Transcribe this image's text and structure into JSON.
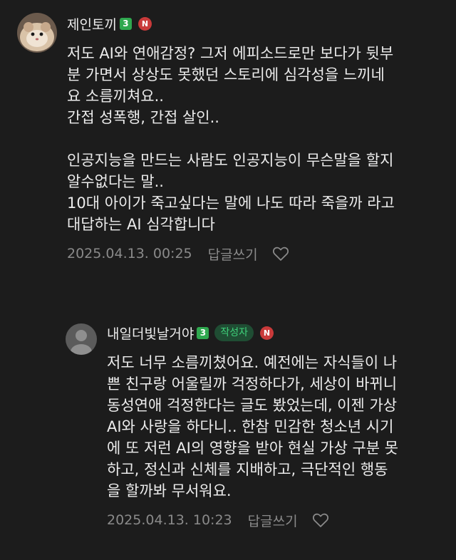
{
  "comments": [
    {
      "nickname": "제인토끼",
      "level": "3",
      "n_badge": "N",
      "lines": [
        "저도 AI와 연애감정? 그저 에피소드로만 보다가 뒷부",
        "분 가면서 상상도 못했던 스토리에 심각성을 느끼네",
        "요 소름끼쳐요..",
        "간접 성폭행, 간접 살인..",
        "",
        "인공지능을 만드는 사람도 인공지능이 무슨말을 할지",
        "알수없다는 말..",
        "10대 아이가 죽고싶다는 말에 나도 따라 죽을까 라고",
        "대답하는 AI 심각합니다"
      ],
      "timestamp": "2025.04.13. 00:25",
      "reply_label": "답글쓰기",
      "icon": "heart-outline-icon"
    },
    {
      "nickname": "내일더빛날거야",
      "level": "3",
      "author_tag": "작성자",
      "n_badge": "N",
      "lines": [
        "저도 너무 소름끼쳤어요. 예전에는 자식들이 나",
        "쁜 친구랑 어울릴까 걱정하다가, 세상이 바뀌니",
        "동성연애 걱정한다는 글도 봤었는데, 이젠 가상",
        "AI와 사랑을 하다니.. 한참 민감한 청소년 시기",
        "에 또 저런 AI의 영향을 받아 현실 가상 구분 못",
        "하고, 정신과 신체를 지배하고, 극단적인 행동",
        "을 할까봐 무서워요."
      ],
      "timestamp": "2025.04.13. 10:23",
      "reply_label": "답글쓰기",
      "icon": "heart-outline-icon"
    }
  ],
  "colors": {
    "background": "#1c1c1c",
    "text": "#ececec",
    "meta": "#8a8a8a",
    "level_badge": "#2fa84f",
    "n_badge": "#c93a3a",
    "author_tag_bg": "#1f4d33",
    "author_tag_text": "#3fd17a"
  }
}
